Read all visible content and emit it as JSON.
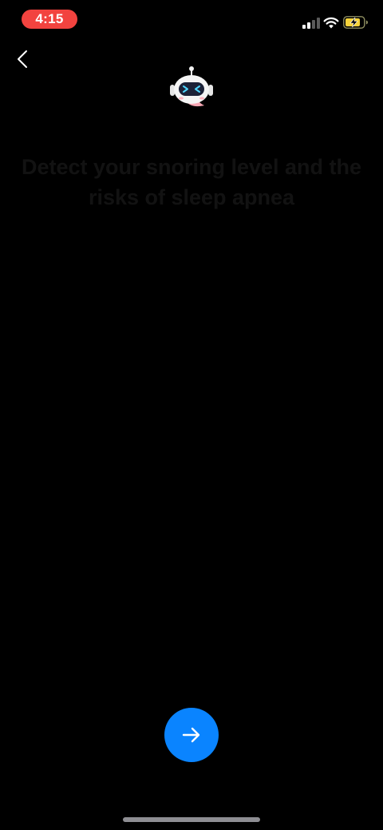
{
  "status_bar": {
    "time": "4:15",
    "time_pill_color": "#f2433f",
    "battery_state": "charging",
    "icons": [
      "signal-icon",
      "wifi-icon",
      "battery-charging-icon"
    ]
  },
  "navigation": {
    "back_icon": "chevron-left-icon"
  },
  "mascot": {
    "icon": "robot-icon"
  },
  "headline": {
    "text": "Detect your snoring level and the risks of sleep apnea"
  },
  "next_button": {
    "icon": "arrow-right-icon",
    "color": "#0a84ff"
  }
}
